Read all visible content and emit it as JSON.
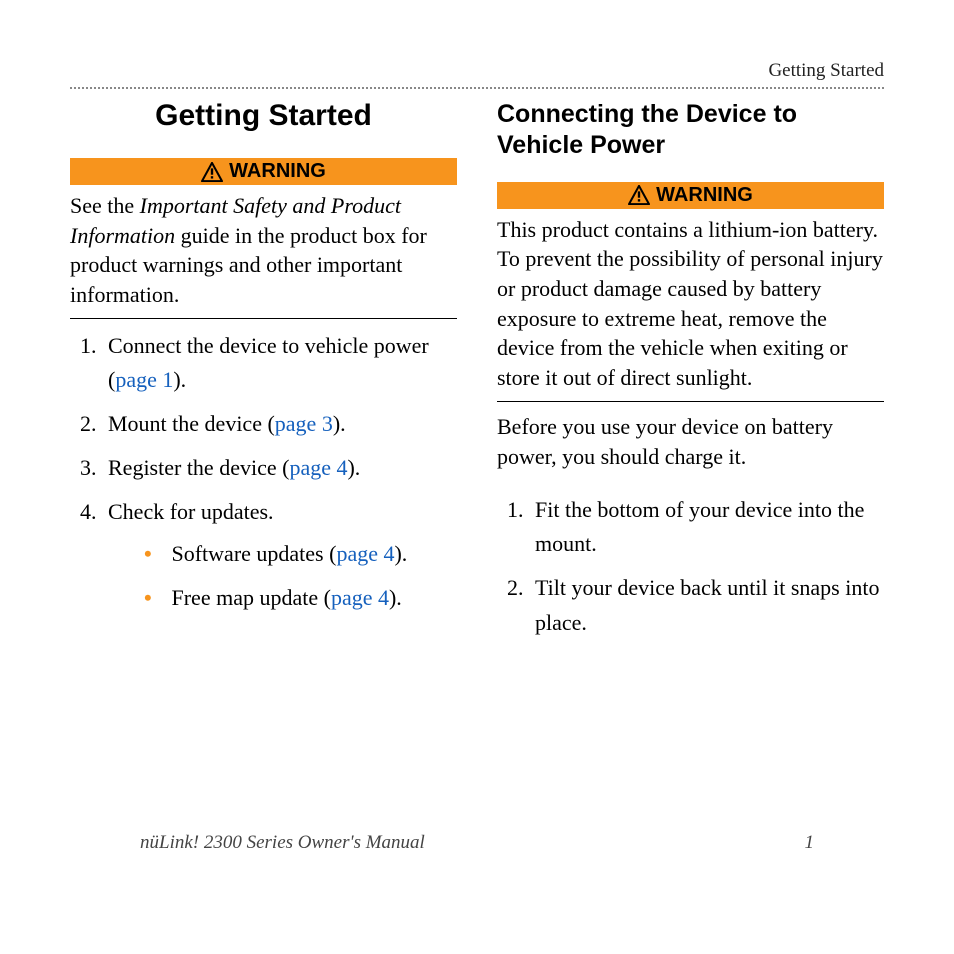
{
  "header": {
    "section_label": "Getting Started"
  },
  "left": {
    "title": "Getting Started",
    "warning": {
      "label": "WARNING",
      "text_before": "See the ",
      "text_italic": "Important Safety and Product Information",
      "text_after": " guide in the product box for product warnings and other important information."
    },
    "steps": {
      "s1_a": "Connect the device to vehicle power (",
      "s1_link": "page 1",
      "s1_b": ").",
      "s2_a": "Mount the device (",
      "s2_link": "page 3",
      "s2_b": ").",
      "s3_a": "Register the device (",
      "s3_link": "page 4",
      "s3_b": ").",
      "s4": "Check for updates.",
      "s4_sub1_a": "Software updates (",
      "s4_sub1_link": "page 4",
      "s4_sub1_b": ").",
      "s4_sub2_a": "Free map update (",
      "s4_sub2_link": "page 4",
      "s4_sub2_b": ")."
    }
  },
  "right": {
    "title": "Connecting the Device to Vehicle Power",
    "warning": {
      "label": "WARNING",
      "text": "This product contains a lithium-ion battery. To prevent the possibility of personal injury or product damage caused by battery exposure to extreme heat, remove the device from the vehicle when exiting or store it out of direct sunlight."
    },
    "intro": "Before you use your device on battery power, you should charge it.",
    "steps": {
      "s1": "Fit the bottom of your device into the mount.",
      "s2": "Tilt your device back until it snaps into place."
    }
  },
  "footer": {
    "manual": "nüLink! 2300 Series Owner's Manual",
    "page": "1"
  }
}
